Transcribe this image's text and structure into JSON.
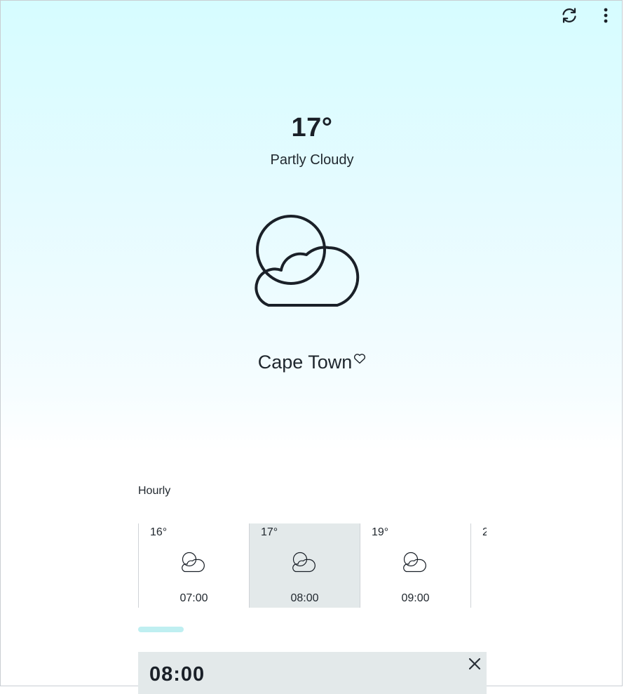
{
  "header": {
    "refresh_icon": "refresh-icon",
    "menu_icon": "more-vertical-icon"
  },
  "current": {
    "temperature": "17°",
    "condition": "Partly Cloudy",
    "icon": "partly-cloudy-icon",
    "location": "Cape Town",
    "favorite_icon": "heart-outline-icon"
  },
  "hourly": {
    "title": "Hourly",
    "items": [
      {
        "temp": "16°",
        "time": "07:00",
        "icon": "partly-cloudy-icon",
        "selected": false
      },
      {
        "temp": "17°",
        "time": "08:00",
        "icon": "partly-cloudy-icon",
        "selected": true
      },
      {
        "temp": "19°",
        "time": "09:00",
        "icon": "partly-cloudy-icon",
        "selected": false
      },
      {
        "temp": "2",
        "time": "",
        "icon": "partly-cloudy-icon",
        "selected": false
      }
    ]
  },
  "detail": {
    "time": "08:00",
    "close_icon": "close-icon"
  },
  "colors": {
    "sky_top": "#d6fcff",
    "selected_bg": "#e3e9ea",
    "scroll_thumb": "#bfeff1",
    "text": "#1a2028"
  }
}
